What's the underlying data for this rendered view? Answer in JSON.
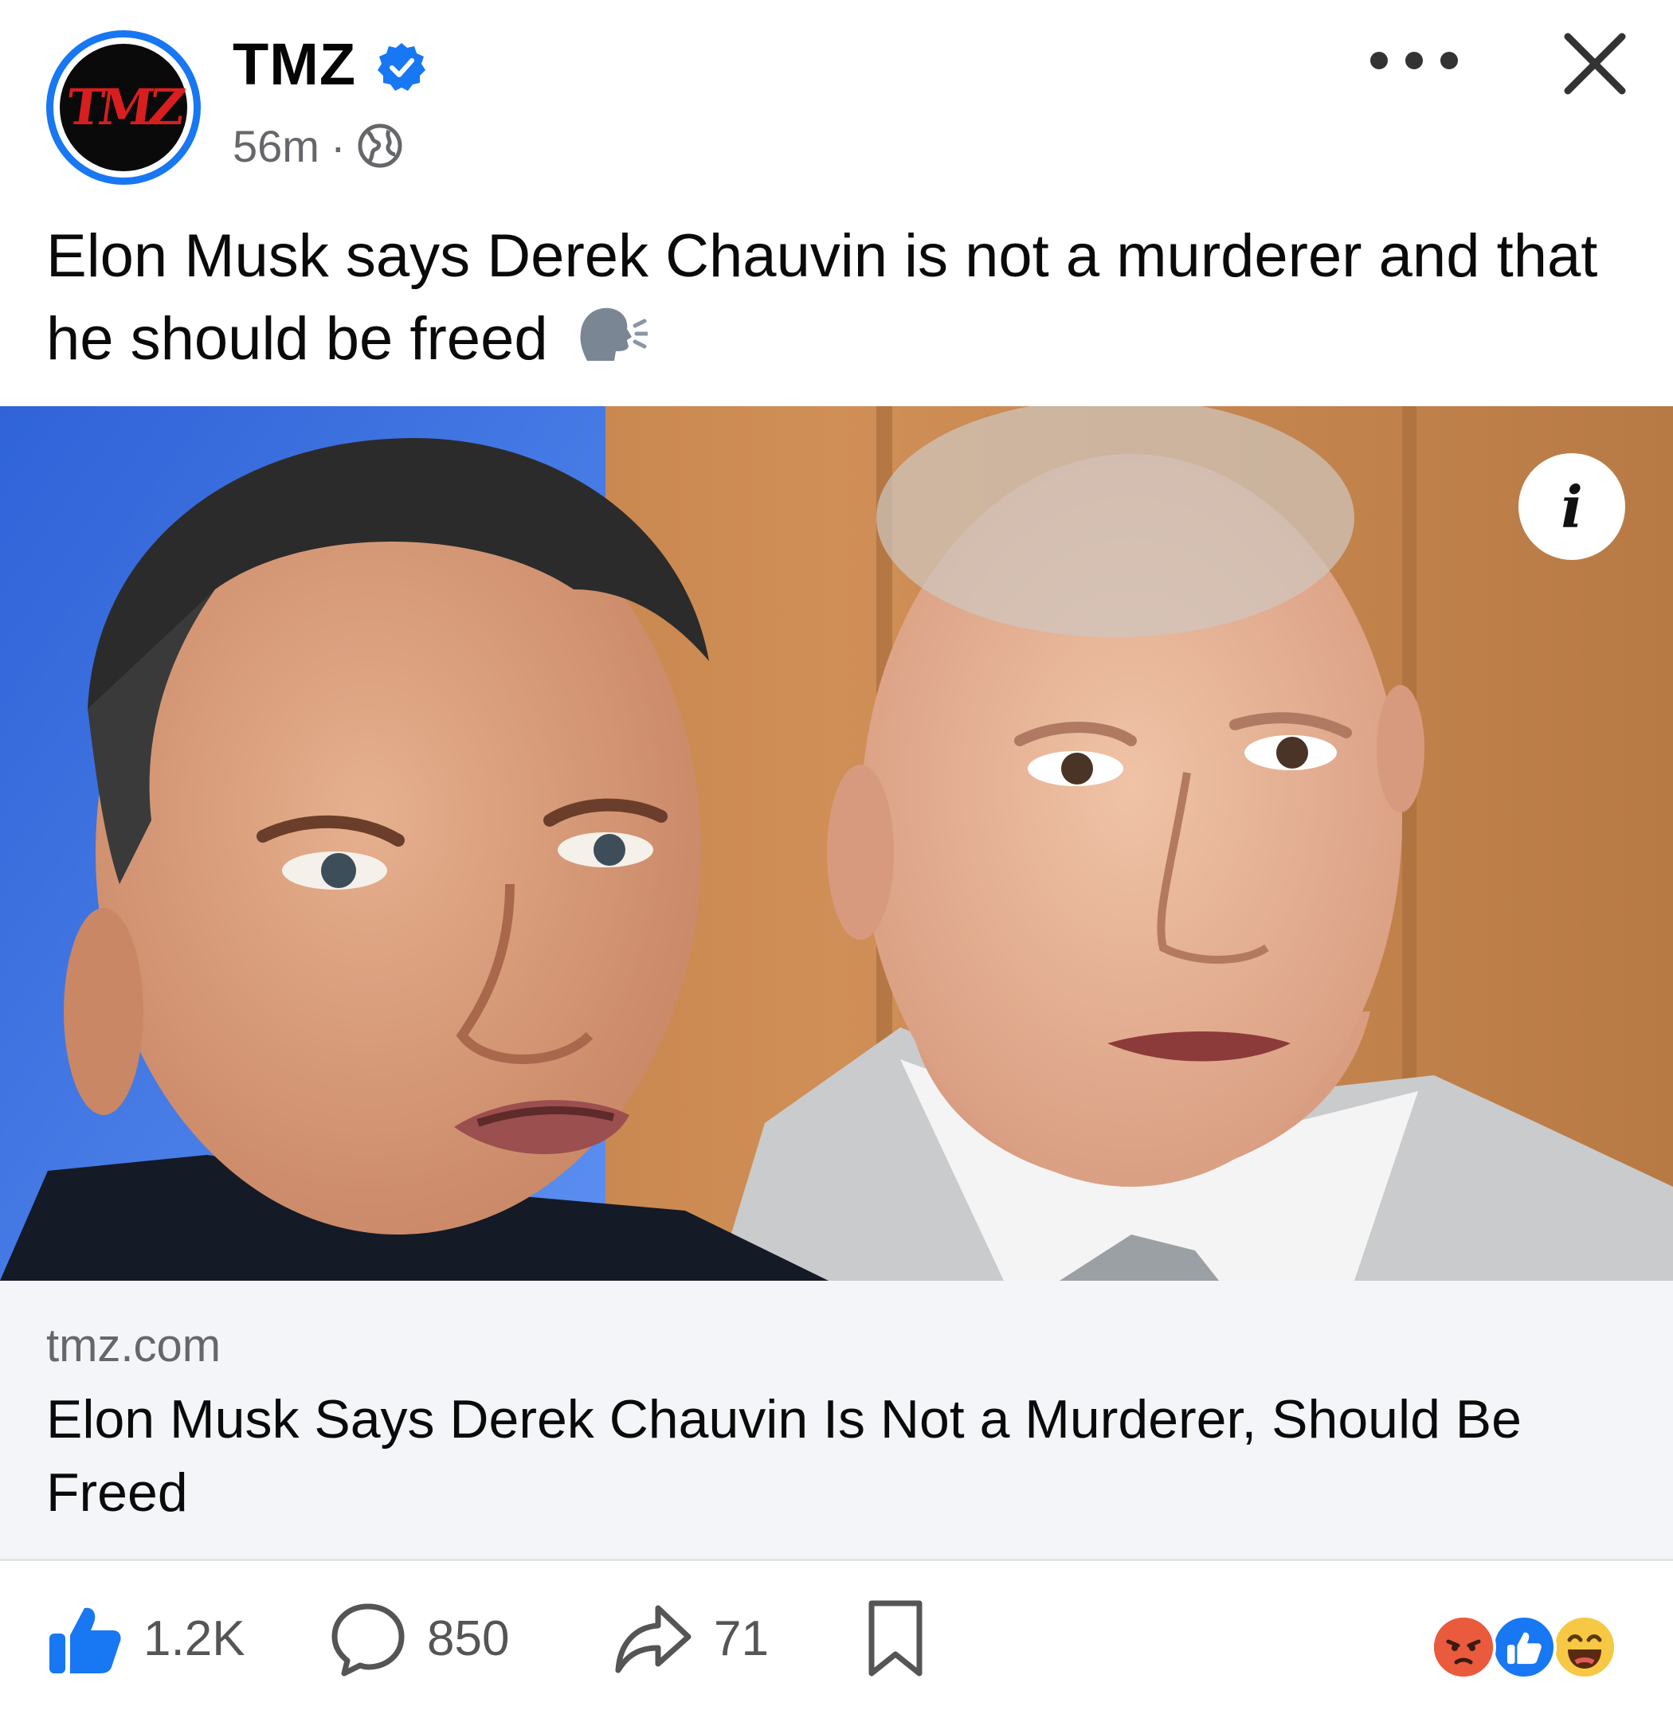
{
  "post": {
    "page_name": "TMZ",
    "avatar_text": "TMZ",
    "time": "56m",
    "separator": "·",
    "caption": "Elon Musk says Derek Chauvin is not a murderer and that he should be freed",
    "caption_emoji": "speaking-head-emoji"
  },
  "link": {
    "domain": "tmz.com",
    "title": "Elon Musk Says Derek Chauvin Is Not a Murderer, Should Be Freed"
  },
  "info_label": "i",
  "actions": {
    "likes": "1.2K",
    "comments": "850",
    "shares": "71"
  },
  "reactions": [
    "angry",
    "like",
    "haha"
  ],
  "colors": {
    "brand_blue": "#1877f2",
    "tmz_red": "#d81e1e",
    "muted_text": "#65676b",
    "link_bg": "#f4f5f8"
  },
  "icons": [
    "verified-badge-icon",
    "globe-icon",
    "more-options-icon",
    "close-icon",
    "info-icon",
    "like-icon",
    "comment-icon",
    "share-icon",
    "bookmark-icon"
  ]
}
